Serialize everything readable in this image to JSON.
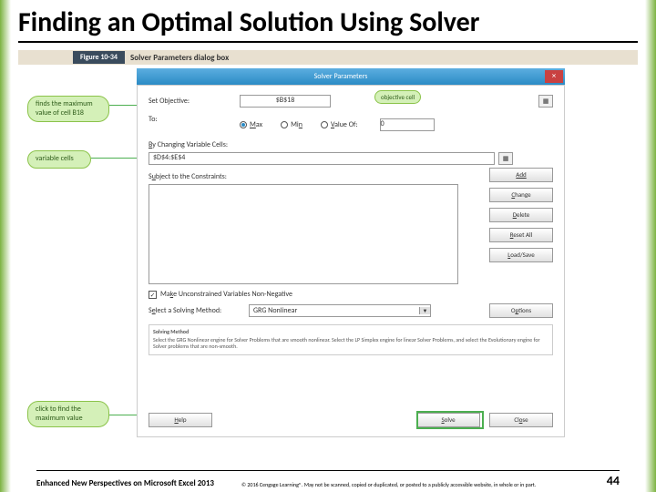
{
  "slide": {
    "title": "Finding an Optimal Solution Using Solver",
    "figure_number": "Figure 10-34",
    "figure_caption": "Solver Parameters dialog box"
  },
  "callouts": {
    "c1": "finds the maximum value of cell B18",
    "c2": "variable cells",
    "c3": "click to find the maximum value",
    "objective": "objective cell"
  },
  "dialog": {
    "title": "Solver Parameters",
    "set_objective_label": "Set Objective:",
    "set_objective_value": "$B$18",
    "to_label": "To:",
    "radio": {
      "max": "Max",
      "min": "Min",
      "valueof": "Value Of:"
    },
    "valueof_input": "0",
    "changing_label": "By Changing Variable Cells:",
    "changing_value": "$D$4:$E$4",
    "constraints_label": "Subject to the Constraints:",
    "buttons": {
      "add": "Add",
      "change": "Change",
      "delete": "Delete",
      "resetall": "Reset All",
      "loadsave": "Load/Save",
      "options": "Options",
      "help": "Help",
      "solve": "Solve",
      "close": "Close"
    },
    "checkbox_label": "Make Unconstrained Variables Non-Negative",
    "method_label": "Select a Solving Method:",
    "method_value": "GRG Nonlinear",
    "method_heading": "Solving Method",
    "method_text": "Select the GRG Nonlinear engine for Solver Problems that are smooth nonlinear. Select the LP Simplex engine for linear Solver Problems, and select the Evolutionary engine for Solver problems that are non-smooth."
  },
  "footer": {
    "left": "Enhanced New Perspectives on Microsoft Excel 2013",
    "mid": "© 2016 Cengage Learning®. May not be scanned, copied or duplicated, or posted to a publicly accessible website, in whole or in part.",
    "page": "44"
  }
}
